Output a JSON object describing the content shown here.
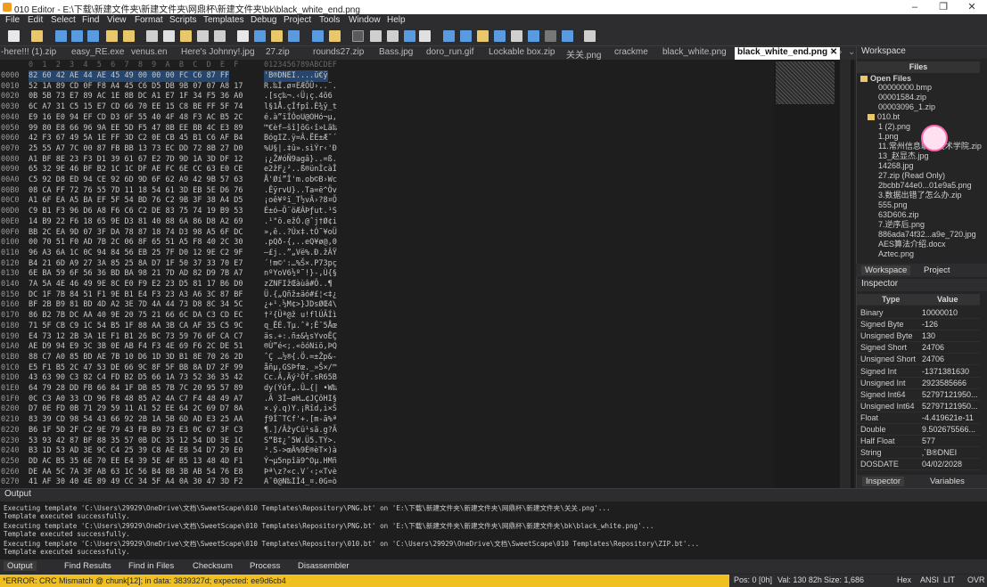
{
  "title": "010 Editor - E:\\下载\\新建文件夹\\新建文件夹\\网鼎杯\\新建文件夹\\bk\\black_white_end.png",
  "menu": [
    "File",
    "Edit",
    "Select",
    "Find",
    "View",
    "Format",
    "Scripts",
    "Templates",
    "Debug",
    "Project",
    "Tools",
    "Window",
    "Help"
  ],
  "tabs": [
    "-here!!! (1).zip",
    "easy_RE.exe",
    "venus.en",
    "Here's Johnny!.jpg",
    "27.zip",
    "rounds27.zip",
    "Bass.jpg",
    "doro_run.gif",
    "Lockable box.zip",
    "关关.png",
    "crackme",
    "black_white.png",
    "black_white_end.png"
  ],
  "active_tab": "black_white_end.png",
  "hex": {
    "col_header": "0  1  2  3  4  5  6  7  8  9  A  B  C  D  E  F",
    "ascii_header": "0123456789ABCDEF",
    "rows": [
      {
        "addr": "0000",
        "bytes": "82 60 42 AE 44 AE 45 49 00 00 00 FC C6 87 FF",
        "ascii": "'B®DNEI....ü€ÿ"
      },
      {
        "addr": "0010",
        "bytes": "52 1A 89 CD 0F F8 A4 45 C6 D5 DB 9B 07 07 A8 17",
        "ascii": "R.‰Í.ø¤EÆÕÛ›..¨."
      },
      {
        "addr": "0020",
        "bytes": "0B 5B 73 E7 89 AC 1E 8B DC A1 E7 1F 34 F5 36 A0",
        "ascii": ".[sç‰¬.‹Ü¡ç.4õ6 "
      },
      {
        "addr": "0030",
        "bytes": "6C A7 31 C5 15 E7 CD 66 70 EE 15 C8 BE FF 5F 74",
        "ascii": "l§1Å.çÍfpî.È¾ÿ_t"
      },
      {
        "addr": "0040",
        "bytes": "E9 16 E0 94 EF CD D3 6F 55 40 4F 48 F3 AC B5 2C",
        "ascii": "é.à”ïÍÓoU@OHó¬µ,"
      },
      {
        "addr": "0050",
        "bytes": "99 80 E8 66 96 9A EE 5D F5 47 8B EE BB 4C E3 89",
        "ascii": "™€èf–šî]õG‹î»Lã‰"
      },
      {
        "addr": "0060",
        "bytes": "42 F3 67 49 5A 1E FF 3D C2 0E CB 45 B1 C6 AF B4",
        "ascii": "BógIZ.ÿ=Â.ËE±Æ¯´"
      },
      {
        "addr": "0070",
        "bytes": "25 55 A7 7C 00 87 FB BB 13 73 EC DD 72 8B 27 D0",
        "ascii": "%U§|.‡û».sìÝr‹'Ð"
      },
      {
        "addr": "0080",
        "bytes": "A1 BF 8E 23 F3 D1 39 61 67 E2 7D 9D 1A 3D DF 12",
        "ascii": "¡¿Ž#óÑ9agâ}..=ß."
      },
      {
        "addr": "0090",
        "bytes": "65 32 9E 46 BF B2 1C 1C DF AE FC 6E CC 63 E0 CE",
        "ascii": "e2žF¿²..ß®ünÌcàÎ"
      },
      {
        "addr": "00A0",
        "bytes": "C5 92 D8 ED 94 CE 92 6D 9D 6F 62 A9 42 9B 57 63",
        "ascii": "Å'Øí”Î'm.ob©B›Wc"
      },
      {
        "addr": "00B0",
        "bytes": "08 CA FF 72 76 55 7D 11 18 54 61 3D EB 5E D6 76",
        "ascii": ".ÊÿrvU}..Ta=ë^Öv"
      },
      {
        "addr": "00C0",
        "bytes": "A1 6F EA A5 BA EF 5F 54 BD 76 C2 9B 3F 38 A4 D5",
        "ascii": "¡oê¥ºï_T½vÂ›?8¤Õ"
      },
      {
        "addr": "00D0",
        "bytes": "C9 B1 F3 96 D6 A8 F6 C6 C2 DE 83 75 74 19 B9 53",
        "ascii": "É±ó–Ö¨öÆÂÞƒut.¹S"
      },
      {
        "addr": "00E0",
        "bytes": "14 B9 22 F6 18 65 9E D3 81 40 88 6A 86 D8 A2 69",
        "ascii": ".¹\"ö.ežÓ.@ˆj†Ø¢i"
      },
      {
        "addr": "00F0",
        "bytes": "BB 2C EA 9D 07 3F DA 78 87 18 74 D3 98 A5 6F DC",
        "ascii": "»,ê..?Úx‡.tÓ˜¥oÜ"
      },
      {
        "addr": "0100",
        "bytes": "00 70 51 F0 AD 7B 2C 06 8F 65 51 A5 F8 40 2C 30",
        "ascii": ".pQð-{,..eQ¥ø@,0"
      },
      {
        "addr": "0110",
        "bytes": "96 A3 6A 1C 0C 94 84 56 EB 25 7F D0 12 9E C2 9F",
        "ascii": "–£j..”„Vë%.Ð.žÂŸ"
      },
      {
        "addr": "0120",
        "bytes": "B4 21 6D A9 27 3A 85 25 8A D7 1F 50 37 33 70 E7",
        "ascii": "´!m©':…%Š×.P73pç"
      },
      {
        "addr": "0130",
        "bytes": "6E BA 59 6F 56 36 BD BA 98 21 7D AD 82 D9 7B A7",
        "ascii": "nºYoV6½º˜!}-‚Ù{§"
      },
      {
        "addr": "0140",
        "bytes": "7A 5A 4E 46 49 9E 8C E0 F9 E2 23 D5 81 17 B6 D0",
        "ascii": "zZNFIžŒàùâ#Õ..¶"
      },
      {
        "addr": "0150",
        "bytes": "DC 1F 7B 84 51 F1 9E B1 E4 F3 23 A3 A6 3C 87 BF",
        "ascii": "Ü.{„Qñž±äó#£¦<‡¿"
      },
      {
        "addr": "0160",
        "bytes": "BF 2B B9 81 BD 4D A2 3E 7D 4A 44 73 D8 8C 34 5C",
        "ascii": "¿+¹.½M¢>}JDsØŒ4\\"
      },
      {
        "addr": "0170",
        "bytes": "86 B2 7B DC AA 40 9E 20 75 21 66 6C DA C3 CD EC",
        "ascii": "†²{Üª@ž u!flÚÃÍì"
      },
      {
        "addr": "0180",
        "bytes": "71 5F CB C9 1C 54 B5 1F 88 AA 3B CA AF 35 C5 9C",
        "ascii": "q_ËÉ.Tµ.ˆª;Ê¯5Åœ"
      },
      {
        "addr": "0190",
        "bytes": "E4 73 12 2B 3A 1E F1 B1 26 BC 73 59 76 6F CA C7",
        "ascii": "äs.+:.ñ±&¼sYvoÊÇ"
      },
      {
        "addr": "01A0",
        "bytes": "AE D9 94 E9 3C 3B 0E AB F4 F3 4E 69 F6 2C DE 51",
        "ascii": "®Ù”é<;.«ôóNiö,ÞQ"
      },
      {
        "addr": "01B0",
        "bytes": "88 C7 A0 85 BD AE 7B 10 D6 1D 3D B1 8E 70 26 2D",
        "ascii": "ˆÇ …½®{.Ö.=±Žp&-"
      },
      {
        "addr": "01C0",
        "bytes": "E5 F1 B5 2C 47 53 DE 66 9C 8F 5F BB 8A D7 2F 99",
        "ascii": "åñµ,GSÞfœ._»Š×/™"
      },
      {
        "addr": "01D0",
        "bytes": "43 63 90 C3 82 C4 FD B2 D5 66 1A 73 52 36 35 42",
        "ascii": "Cc.Ã‚Äý²Õf.sR65B"
      },
      {
        "addr": "01E0",
        "bytes": "64 79 28 DD FB 66 84 1F DB 85 7B 7C 20 95 57 89",
        "ascii": "dy(Ýûf„.Û…{| •W‰"
      },
      {
        "addr": "01F0",
        "bytes": "0C C3 A0 33 CD 96 F8 48 85 A2 4A C7 F4 48 49 A7",
        "ascii": ".Ã 3Í–øH…¢JÇôHI§"
      },
      {
        "addr": "0200",
        "bytes": "D7 0E FD 0B 71 29 59 11 A1 52 EE 64 2C 69 D7 8A",
        "ascii": "×.ý.q)Y.¡Rîd,i×Š"
      },
      {
        "addr": "0210",
        "bytes": "83 39 CD 98 54 43 66 92 2B 1A 5B 6D AD E3 25 AA",
        "ascii": "ƒ9Í˜TCf'+.[m-ã%ª"
      },
      {
        "addr": "0220",
        "bytes": "B6 1F 5D 2F C2 9E 79 43 FB B9 73 E3 0C 67 3F C3",
        "ascii": "¶.]/ÂžyCû¹sã.g?Ã"
      },
      {
        "addr": "0230",
        "bytes": "53 93 42 87 BF 88 35 57 0B DC 35 12 54 DD 3E 1C",
        "ascii": "S“B‡¿ˆ5W.Ü5.TÝ>."
      },
      {
        "addr": "0240",
        "bytes": "B3 1D 53 AD 3E 9C C4 25 39 C8 AE E8 54 D7 29 E0",
        "ascii": "³.S->œÄ%9È®èT×)à"
      },
      {
        "addr": "0250",
        "bytes": "DD AC B5 35 6E 70 EE E4 39 5E 4F B5 13 48 4D F1",
        "ascii": "Ý¬µ5npîä9^Oµ.HMñ"
      },
      {
        "addr": "0260",
        "bytes": "DE AA 5C 7A 3F AB 63 1C 56 B4 8B 3B AB 54 76 E8",
        "ascii": "Þª\\z?«c.V´‹;«Tvè"
      },
      {
        "addr": "0270",
        "bytes": "41 AF 30 40 4E 89 49 CC 34 5F A4 0A 30 47 3D F2",
        "ascii": "A¯0@N‰IÌ4_¤.0G=ò"
      }
    ]
  },
  "workspace": {
    "title": "Workspace",
    "files_label": "Files",
    "open_files_label": "Open Files",
    "items": [
      "00000000.bmp",
      "00001584.zip",
      "00003096_1.zip",
      "010.bt",
      "1 (2).png",
      "1.png",
      "11.常州信息职业技术学院.zip",
      "13_赵显杰.jpg",
      "14268.jpg",
      "27.zip (Read Only)",
      "2bcbb744e0...01e9a5.png",
      "3.数据出错了怎么办.zip",
      "555.png",
      "63D606.zip",
      "7.逆序后.png",
      "886ada74f32...a9e_720.jpg",
      "AES算法介绍.docx",
      "Aztec.png"
    ],
    "tab_workspace": "Workspace",
    "tab_project": "Project"
  },
  "inspector": {
    "title": "Inspector",
    "col_type": "Type",
    "col_value": "Value",
    "rows": [
      {
        "type": "Binary",
        "value": "10000010"
      },
      {
        "type": "Signed Byte",
        "value": "-126"
      },
      {
        "type": "Unsigned Byte",
        "value": "130"
      },
      {
        "type": "Signed Short",
        "value": "24706"
      },
      {
        "type": "Unsigned Short",
        "value": "24706"
      },
      {
        "type": "Signed Int",
        "value": "-1371381630"
      },
      {
        "type": "Unsigned Int",
        "value": "2923585666"
      },
      {
        "type": "Signed Int64",
        "value": "52797121950..."
      },
      {
        "type": "Unsigned Int64",
        "value": "52797121950..."
      },
      {
        "type": "Float",
        "value": "-4.419621e-11"
      },
      {
        "type": "Double",
        "value": "9.502675566..."
      },
      {
        "type": "Half Float",
        "value": "577"
      },
      {
        "type": "String",
        "value": "‚`B®DNEI"
      },
      {
        "type": "DOSDATE",
        "value": "04/02/2028"
      }
    ],
    "tab_inspector": "Inspector",
    "tab_variables": "Variables"
  },
  "output": {
    "title": "Output",
    "lines": [
      "Executing template 'C:\\Users\\29929\\OneDrive\\文档\\SweetScape\\010 Templates\\Repository\\PNG.bt' on 'E:\\下载\\新建文件夹\\新建文件夹\\网鼎杯\\新建文件夹\\关关.png'...",
      "Template executed successfully.",
      "Executing template 'C:\\Users\\29929\\OneDrive\\文档\\SweetScape\\010 Templates\\Repository\\PNG.bt' on 'E:\\下载\\新建文件夹\\新建文件夹\\网鼎杯\\新建文件夹\\bk\\black_white.png'...",
      "Template executed successfully.",
      "Executing template 'C:\\Users\\29929\\OneDrive\\文档\\SweetScape\\010 Templates\\Repository\\010.bt' on 'C:\\Users\\29929\\OneDrive\\文档\\SweetScape\\010 Templates\\Repository\\ZIP.bt'...",
      "Template executed successfully."
    ],
    "tabs": [
      "Output",
      "Find Results",
      "Find in Files",
      "Checksum",
      "Process",
      "Disassembler"
    ]
  },
  "status": {
    "error": "*ERROR: CRC Mismatch @ chunk[12]; in data: 3839327d; expected: ee9d6cb4",
    "pos": "Pos: 0 [0h]",
    "val": "Val: 130 82h",
    "size": "Size: 1,686",
    "hex": "Hex",
    "ansi": "ANSI",
    "lit": "LIT",
    "ovr": "OVR"
  },
  "colors": {
    "accent": "#f0c020",
    "active_tab": "#ffffff",
    "selection": "#3a6fa8"
  }
}
